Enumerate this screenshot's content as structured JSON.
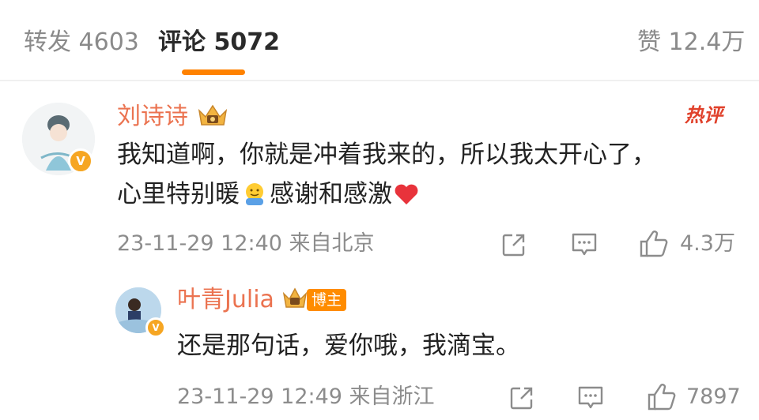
{
  "tabs": {
    "repost": "转发 4603",
    "comments": "评论 5072",
    "likes": "赞 12.4万"
  },
  "comments": [
    {
      "author": "刘诗诗",
      "hot_tag": "热评",
      "text_line1": "我知道啊，你就是冲着我来的，所以我太开心了，",
      "text_line2_a": "心里特别暖",
      "text_line2_b": "感谢和感激",
      "meta": "23-11-29 12:40 来自北京",
      "like_count": "4.3万"
    },
    {
      "author": "叶青Julia",
      "badge": "博主",
      "text": "还是那句话，爱你哦，我滴宝。",
      "meta": "23-11-29 12:49 来自浙江",
      "like_count": "7897"
    }
  ],
  "icons": {
    "share": "share-icon",
    "comment": "comment-icon",
    "like": "thumbs-up-icon",
    "verified": "v-badge-icon",
    "crown": "crown-icon",
    "emoji_hug": "hug-emoji",
    "emoji_heart": "heart-emoji"
  },
  "colors": {
    "accent": "#ff8200",
    "name": "#eb7350",
    "hot": "#e0412b",
    "meta": "#8c8c8c"
  }
}
